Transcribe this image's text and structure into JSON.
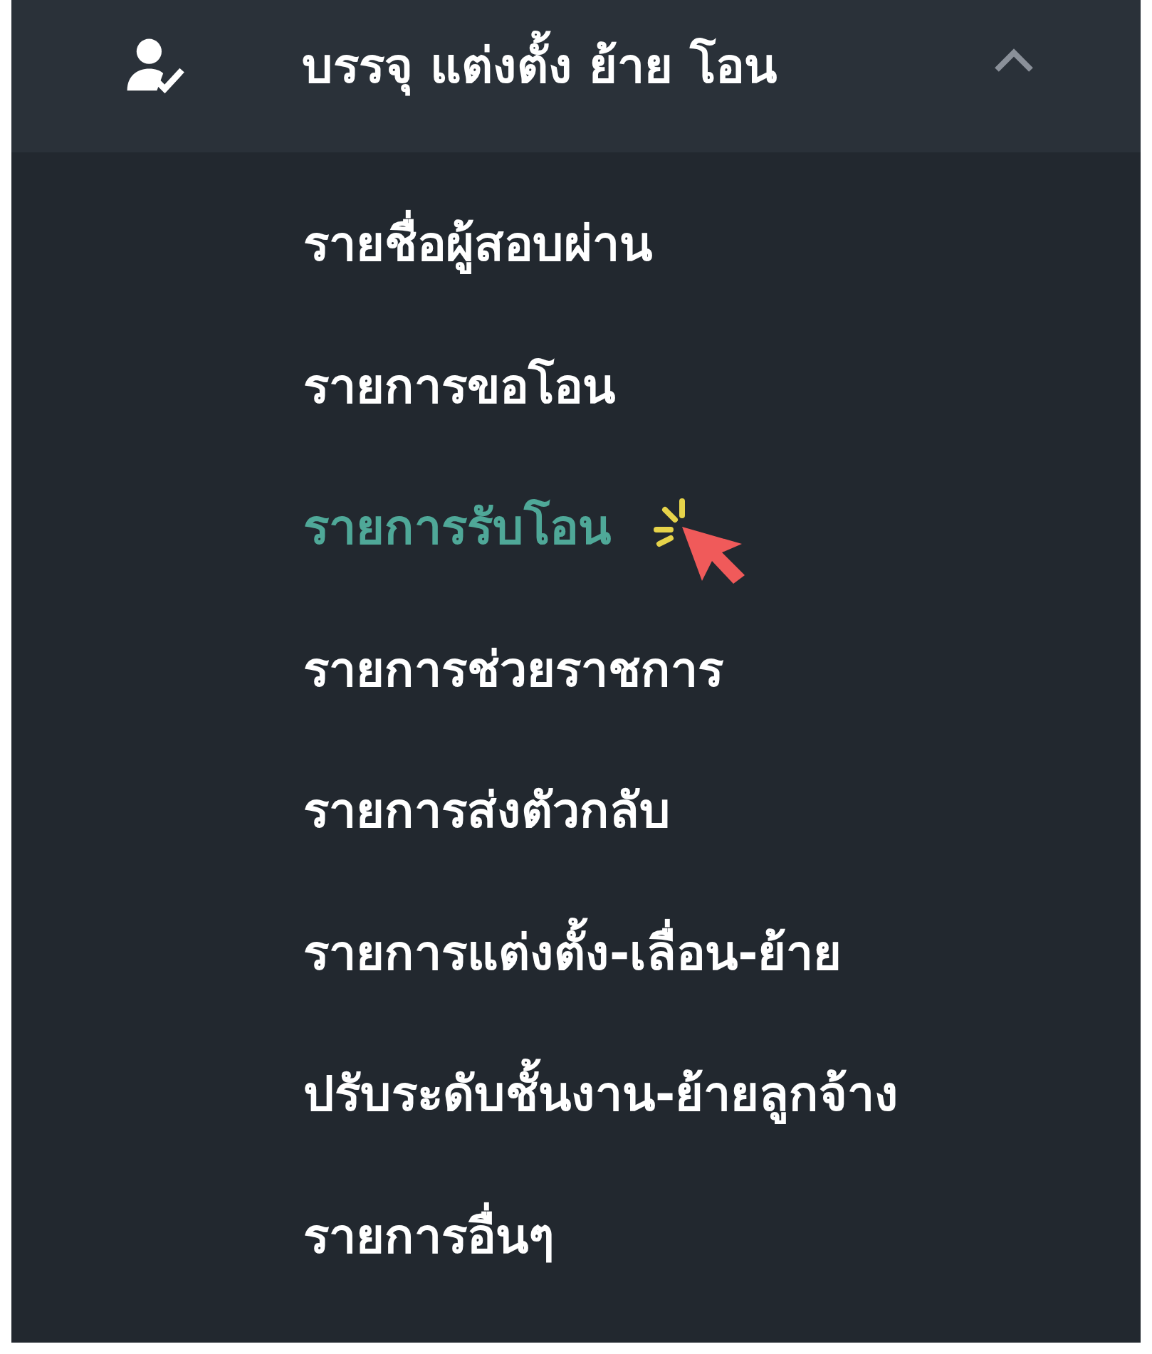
{
  "menu": {
    "title": "บรรจุ แต่งตั้ง ย้าย โอน",
    "expanded": true,
    "items": [
      {
        "label": "รายชื่อผู้สอบผ่าน",
        "selected": false
      },
      {
        "label": "รายการขอโอน",
        "selected": false
      },
      {
        "label": "รายการรับโอน",
        "selected": true
      },
      {
        "label": "รายการช่วยราชการ",
        "selected": false
      },
      {
        "label": "รายการส่งตัวกลับ",
        "selected": false
      },
      {
        "label": "รายการแต่งตั้ง-เลื่อน-ย้าย",
        "selected": false
      },
      {
        "label": "ปรับระดับชั้นงาน-ย้ายลูกจ้าง",
        "selected": false
      },
      {
        "label": "รายการอื่นๆ",
        "selected": false
      }
    ]
  }
}
